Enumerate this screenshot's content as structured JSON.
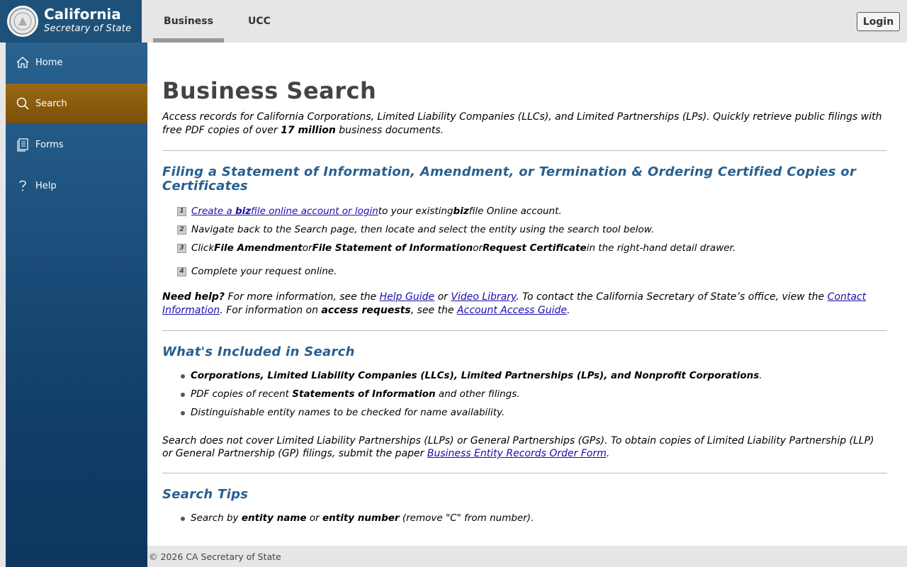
{
  "brand": {
    "title": "California",
    "subtitle": "Secretary of State"
  },
  "tabs": {
    "business": "Business",
    "ucc": "UCC"
  },
  "login_label": "Login",
  "sidebar": {
    "items": [
      {
        "label": "Home",
        "icon": "home-icon"
      },
      {
        "label": "Search",
        "icon": "search-icon",
        "active": true
      },
      {
        "label": "Forms",
        "icon": "forms-icon"
      },
      {
        "label": "Help",
        "icon": "help-icon"
      }
    ]
  },
  "main": {
    "title": "Business Search",
    "intro": {
      "text1": "Access records for California Corporations, Limited Liability Companies (LLCs), and Limited Partnerships (LPs). Quickly retrieve public filings with free PDF copies of over ",
      "bold": "17 million",
      "text2": " business documents."
    },
    "filing": {
      "heading": "Filing a Statement of Information, Amendment, or Termination & Ordering Certified Copies or Certificates",
      "step1": {
        "num": "1",
        "link_pre": "Create a ",
        "link_bold": "biz",
        "link_post": "file online account or login",
        "text_pre": " to your existing ",
        "text_bold": "biz",
        "text_post": "file Online account."
      },
      "step2": {
        "num": "2",
        "text": "Navigate back to the Search page, then locate and select the entity using the search tool below."
      },
      "step3": {
        "num": "3",
        "t1": "Click ",
        "b1": "File Amendment",
        "t2": " or ",
        "b2": "File Statement of Information",
        "t3": " or ",
        "b3": "Request Certificate",
        "t4": " in the right-hand detail drawer."
      },
      "step4": {
        "num": "4",
        "text": "Complete your request online."
      }
    },
    "help": {
      "bold1": "Need help?",
      "t1": " For more information, see the ",
      "link1": "Help Guide",
      "t2": " or ",
      "link2": "Video Library",
      "t3": ". To contact the California Secretary of State’s office, view the ",
      "link3": "Contact Information",
      "t4": ". For information on ",
      "bold2": "access requests",
      "t5": ", see the ",
      "link4": "Account Access Guide",
      "t6": "."
    },
    "included": {
      "heading": "What's Included in Search",
      "b1_bold": "Corporations, Limited Liability Companies (LLCs), Limited Partnerships (LPs), and Nonprofit Corporations",
      "b1_post": ".",
      "b2_pre": "PDF copies of recent ",
      "b2_bold": "Statements of Information",
      "b2_post": " and other filings.",
      "b3": "Distinguishable entity names to be checked for name availability.",
      "note_pre": "Search does not cover Limited Liability Partnerships (LLPs) or General Partnerships (GPs). To obtain copies of Limited Liability Partnership (LLP) or General Partnership (GP) filings, submit the paper ",
      "note_link": "Business Entity Records Order Form",
      "note_post": "."
    },
    "tips": {
      "heading": "Search Tips",
      "t1_pre": "Search by ",
      "t1_b1": "entity name",
      "t1_mid": " or ",
      "t1_b2": "entity number",
      "t1_post": " (remove \"C\" from number)."
    }
  },
  "footer": "© 2026 CA Secretary of State"
}
